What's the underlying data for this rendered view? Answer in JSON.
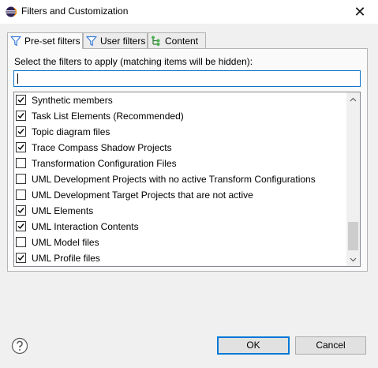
{
  "window": {
    "title": "Filters and Customization",
    "close_symbol": "✕",
    "icon": "eclipse-icon"
  },
  "tabs": [
    {
      "label": "Pre-set filters",
      "icon": "filter-icon",
      "active": true
    },
    {
      "label": "User filters",
      "icon": "filter-icon",
      "active": false
    },
    {
      "label": "Content",
      "icon": "content-tree-icon",
      "active": false
    }
  ],
  "panel": {
    "instruction": "Select the filters to apply (matching items will be hidden):",
    "filter_input_value": ""
  },
  "filters": [
    {
      "label": "Synthetic members",
      "checked": true
    },
    {
      "label": "Task List Elements (Recommended)",
      "checked": true
    },
    {
      "label": "Topic diagram files",
      "checked": true
    },
    {
      "label": "Trace Compass Shadow Projects",
      "checked": true
    },
    {
      "label": "Transformation Configuration Files",
      "checked": false
    },
    {
      "label": "UML Development Projects with no active Transform Configurations",
      "checked": false
    },
    {
      "label": "UML Development Target Projects that are not active",
      "checked": false
    },
    {
      "label": "UML Elements",
      "checked": true
    },
    {
      "label": "UML Interaction Contents",
      "checked": true
    },
    {
      "label": "UML Model files",
      "checked": false
    },
    {
      "label": "UML Profile files",
      "checked": true
    }
  ],
  "footer": {
    "help_icon": "help-icon",
    "ok_label": "OK",
    "cancel_label": "Cancel"
  }
}
